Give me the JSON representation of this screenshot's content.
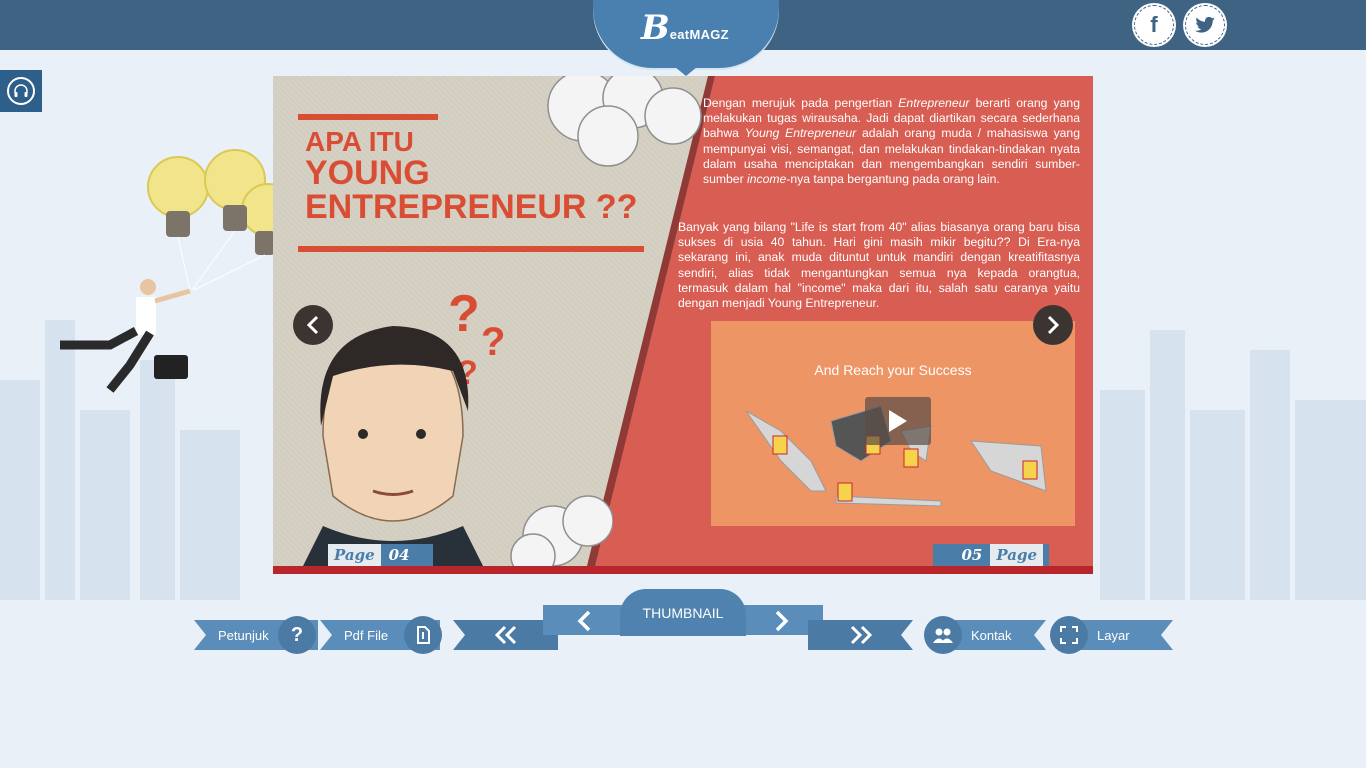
{
  "header": {
    "logo_b": "B",
    "logo_rest": "eatMAGZ",
    "social": [
      {
        "name": "facebook-icon",
        "glyph": "f"
      },
      {
        "name": "twitter-icon",
        "glyph": "t"
      }
    ]
  },
  "book": {
    "left_page": {
      "title_line1": "APA ITU",
      "title_line2": "YOUNG",
      "title_line3": "ENTREPRENEUR ??",
      "page_word": "Page",
      "page_number": "04"
    },
    "right_page": {
      "para1_a": "Dengan merujuk pada pengertian ",
      "para1_b": "Entrepreneur",
      "para1_c": " berarti orang yang melakukan tugas wirausaha. Jadi dapat diartikan secara sederhana bahwa ",
      "para1_d": "Young Entrepreneur",
      "para1_e": " adalah orang muda / mahasiswa yang mempunyai visi, semangat, dan melakukan tindakan-tindakan nyata dalam usaha menciptakan dan mengembangkan sendiri sumber-sumber ",
      "para1_f": "income",
      "para1_g": "-nya tanpa bergantung pada orang lain.",
      "para2": "Banyak yang bilang \"Life is start from 40\" alias biasanya orang baru bisa sukses di usia 40 tahun. Hari gini masih mikir begitu?? Di Era-nya sekarang ini, anak muda dituntut untuk mandiri dengan kreatifitasnya sendiri, alias tidak mengantungkan semua nya kepada orangtua, termasuk dalam hal \"income\" maka dari itu, salah satu caranya yaitu dengan menjadi Young Entrepreneur.",
      "video_caption": "And Reach your Success",
      "page_word": "Page",
      "page_number": "05"
    }
  },
  "toolbar": {
    "petunjuk": "Petunjuk",
    "pdf": "Pdf File",
    "thumbnail": "THUMBNAIL",
    "kontak": "Kontak",
    "layar": "Layar"
  },
  "colors": {
    "topbar": "#3f6382",
    "accent_blue": "#5b8dba",
    "page_red": "#d85d52",
    "title_red": "#d94d34"
  }
}
